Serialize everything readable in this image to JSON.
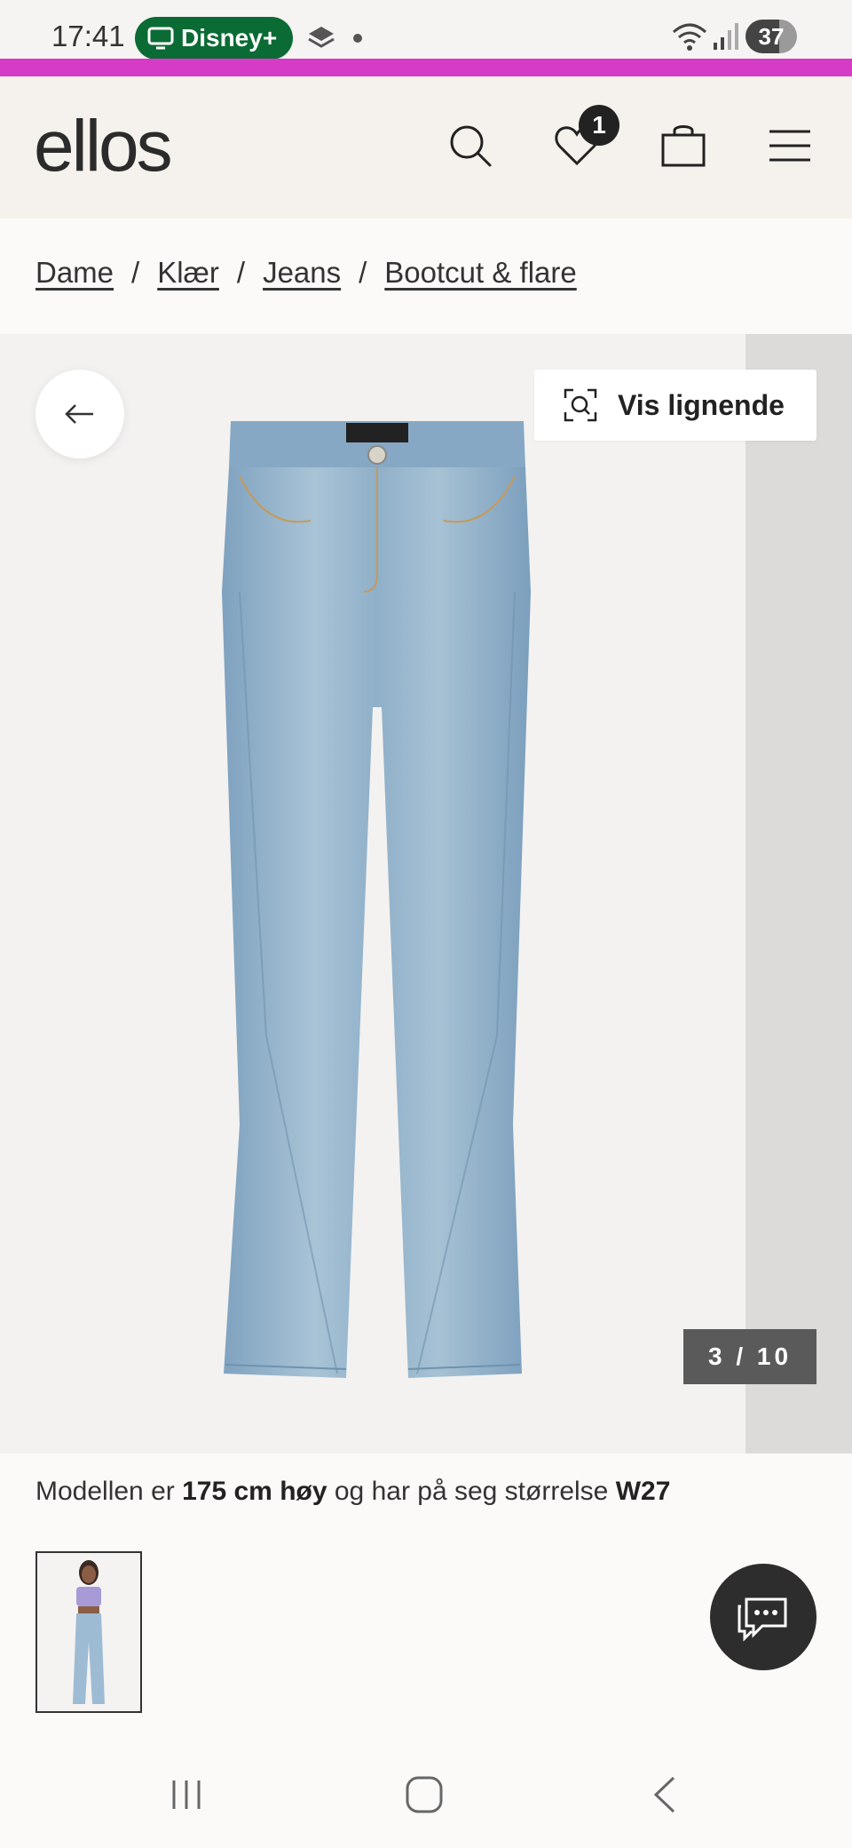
{
  "status_bar": {
    "time": "17:41",
    "app_pill": "Disney+",
    "battery": "37"
  },
  "colors": {
    "promo_line": "#d63bc6",
    "header_bg": "#f5f1ec",
    "pill_bg": "#0b6b34"
  },
  "header": {
    "logo": "ellos",
    "wishlist_count": "1"
  },
  "breadcrumb": [
    {
      "label": "Dame"
    },
    {
      "label": "Klær"
    },
    {
      "label": "Jeans"
    },
    {
      "label": "Bootcut & flare"
    }
  ],
  "breadcrumb_separator": "/",
  "gallery": {
    "similar_button": "Vis lignende",
    "counter": "3 / 10",
    "image_alt": "product-image-jeans"
  },
  "model_info": {
    "prefix": "Modellen er",
    "height": "175 cm høy",
    "middle": "og har på seg størrelse",
    "size": "W27"
  },
  "icons": {
    "search": "search-icon",
    "wishlist": "heart-icon",
    "bag": "shopping-bag-icon",
    "menu": "hamburger-menu-icon",
    "back": "arrow-left-icon",
    "visual_search": "visual-search-icon",
    "chat": "chat-icon"
  }
}
